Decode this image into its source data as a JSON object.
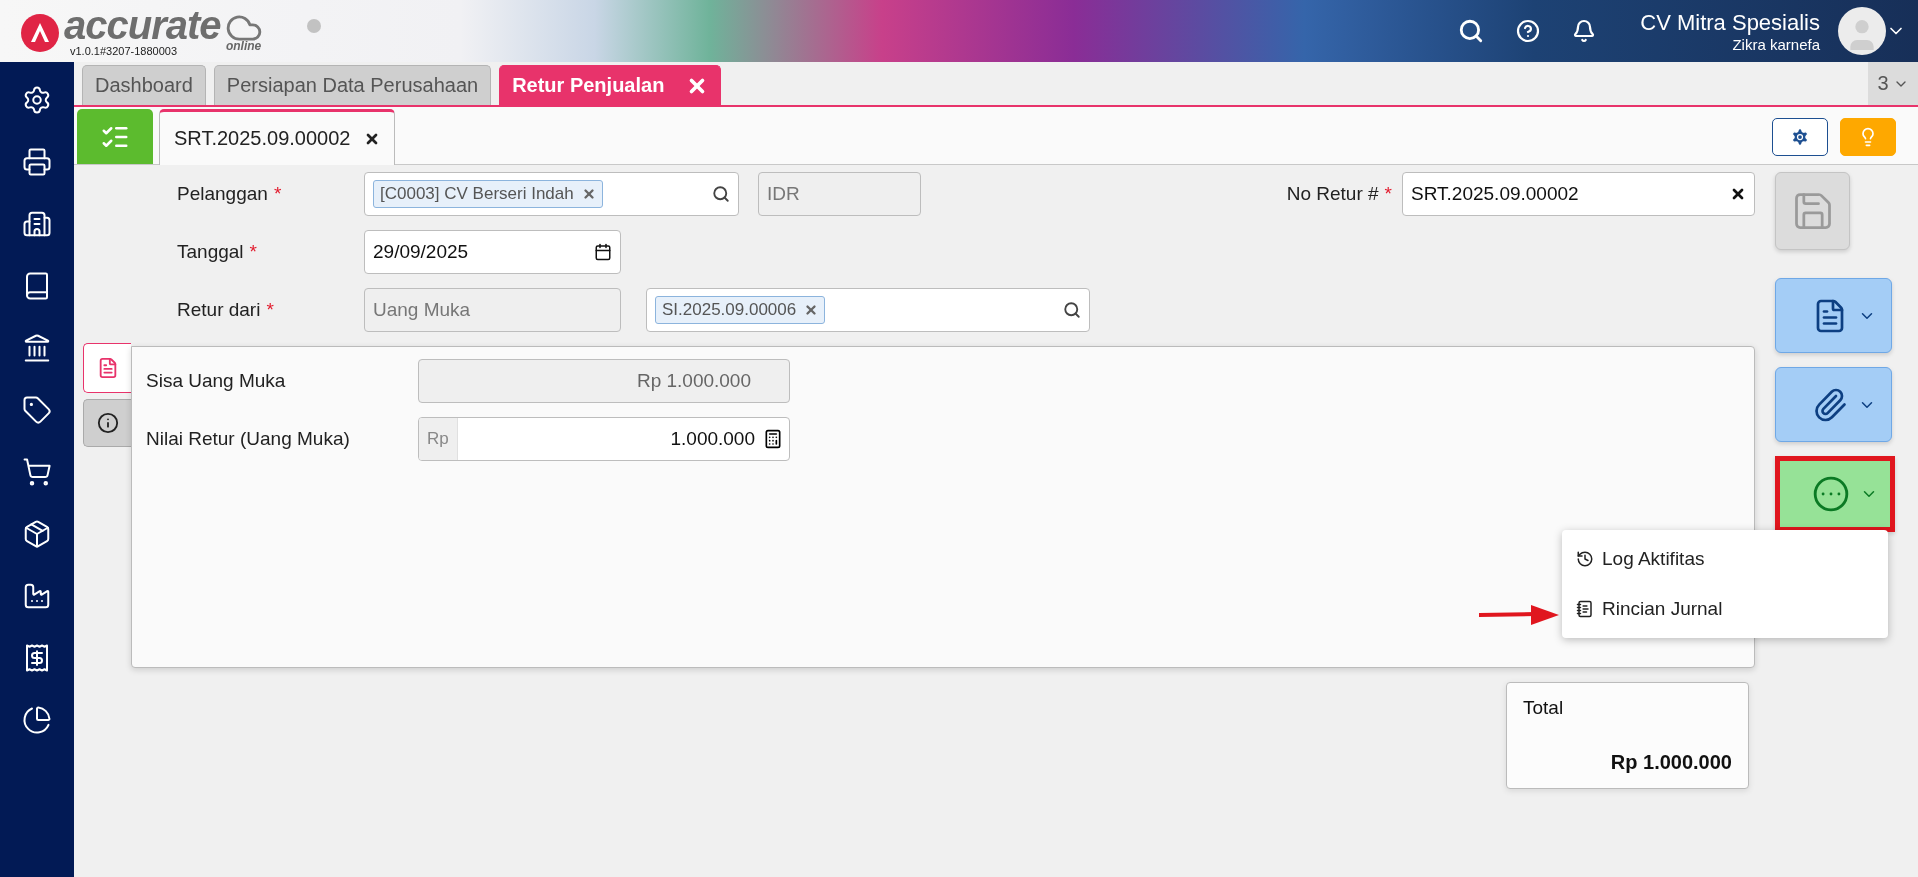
{
  "header": {
    "logo_text": "accurate",
    "logo_sub": "online",
    "version": "v1.0.1#3207-1880003",
    "company": "CV Mitra Spesialis",
    "user": "Zikra karnefa"
  },
  "tabs": [
    {
      "label": "Dashboard",
      "selected": false,
      "closable": false
    },
    {
      "label": "Persiapan Data Perusahaan",
      "selected": false,
      "closable": false
    },
    {
      "label": "Retur Penjualan",
      "selected": true,
      "closable": true
    }
  ],
  "tab_count": "3",
  "document_tabs": [
    {
      "label": "SRT.2025.09.00002",
      "selected": true
    }
  ],
  "form": {
    "pelanggan": {
      "label": "Pelanggan",
      "required_mark": "*",
      "tag": "[C0003] CV Berseri Indah"
    },
    "currency": "IDR",
    "no_retur": {
      "label": "No Retur #",
      "required_mark": "*",
      "value": "SRT.2025.09.00002"
    },
    "tanggal": {
      "label": "Tanggal",
      "required_mark": "*",
      "value": "29/09/2025"
    },
    "retur_dari": {
      "label": "Retur dari",
      "required_mark": "*",
      "source": "Uang Muka",
      "tag": "SI.2025.09.00006"
    }
  },
  "panel": {
    "side_tabs": [
      {
        "kind": "document",
        "selected": true
      },
      {
        "kind": "info",
        "selected": false
      }
    ],
    "rows": [
      {
        "kind": "readonly",
        "label": "Sisa Uang Muka",
        "value": "Rp 1.000.000"
      },
      {
        "kind": "amount",
        "label": "Nilai Retur (Uang Muka)",
        "prefix": "Rp",
        "value": "1.000.000"
      }
    ]
  },
  "actions": {
    "more_highlighted": true
  },
  "menu": {
    "items": [
      {
        "kind": "history",
        "label": "Log Aktifitas"
      },
      {
        "kind": "journal",
        "label": "Rincian Jurnal"
      }
    ],
    "arrow_shown": true
  },
  "total": {
    "label": "Total",
    "value": "Rp 1.000.000"
  }
}
